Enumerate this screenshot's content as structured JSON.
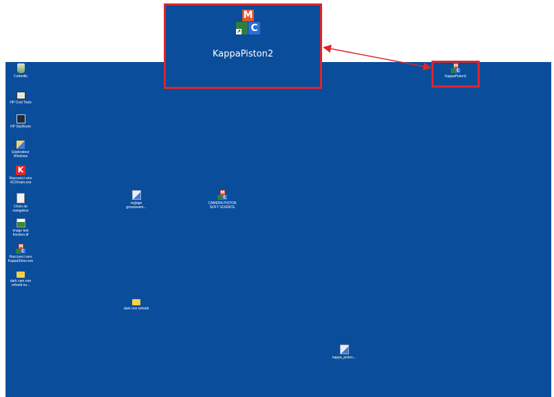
{
  "header": {
    "label": ""
  },
  "desktop": {
    "icons": [
      {
        "name": "Corbeille",
        "kind": "recycle-bin-icon"
      },
      {
        "name": "HP Cool Tools",
        "kind": "tools-icon"
      },
      {
        "name": "HP SkyRoom",
        "kind": "monitor-icon"
      },
      {
        "name": "Explorateur\nWindows",
        "kind": "explorer-icon"
      },
      {
        "name": "Raccourci vers\nXCOmain.exe",
        "kind": "k-app-icon"
      },
      {
        "name": "Choix de\nnavigateur",
        "kind": "document-icon"
      },
      {
        "name": "image test\nfonction.tif",
        "kind": "image-file-icon"
      },
      {
        "name": "Raccourci vers\nKappaSirius.exe",
        "kind": "kappa-blocks-icon"
      },
      {
        "name": "dark cam non\nrefroidi no...",
        "kind": "folder-icon"
      },
      {
        "name": "reglage\ngrossissem...",
        "kind": "tech-file-icon"
      },
      {
        "name": "CAMERA PISTON\nSOFT SCIENCE",
        "kind": "kappa-blocks-icon"
      },
      {
        "name": "dark non refroidi",
        "kind": "folder-icon"
      },
      {
        "name": "kappa_piston...",
        "kind": "tech-file-icon"
      },
      {
        "name": "KappaPiston2",
        "kind": "kappa-blocks-icon"
      }
    ]
  },
  "zoom_callout": {
    "caption": "KappaPiston2",
    "glyph_letters": [
      "M",
      "C"
    ]
  },
  "colors": {
    "desktop_bg": "#0a4d9b",
    "callout_red": "#e0252b"
  }
}
